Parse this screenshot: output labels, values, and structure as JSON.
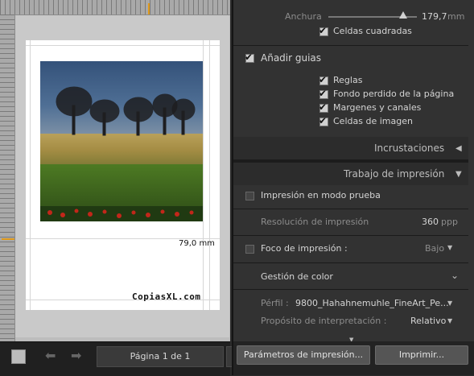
{
  "canvas": {
    "dimension_label": "79,0 mm",
    "watermark": "CopiasXL.com"
  },
  "toolbar": {
    "page_indicator": "Página 1 de 1"
  },
  "panel": {
    "width_label": "Anchura",
    "width_value": "179,7",
    "width_unit": "mm",
    "square_cells": "Celdas cuadradas",
    "add_guides": "Añadir guias",
    "guides": [
      "Reglas",
      "Fondo perdido de la página",
      "Margenes y canales",
      "Celdas de imagen"
    ],
    "overlays_section": "Incrustaciones",
    "print_job_section": "Trabajo de impresión",
    "draft_mode": "Impresión en modo prueba",
    "resolution_label": "Resolución de impresión",
    "resolution_value": "360",
    "resolution_unit": "ppp",
    "sharpen_label": "Foco de impresión :",
    "sharpen_value": "Bajo",
    "color_mgmt_label": "Gestión de color",
    "profile_label": "Pérfil :",
    "profile_value": "9800_Hahahnemuhle_FineArt_Pe...",
    "intent_label": "Propósito de interpretación :",
    "intent_value": "Relativo",
    "print_settings_button": "Parámetros de impresión...",
    "print_button": "Imprimir..."
  },
  "colors": {
    "accent": "#e09a1a",
    "panel_bg": "#323232"
  }
}
